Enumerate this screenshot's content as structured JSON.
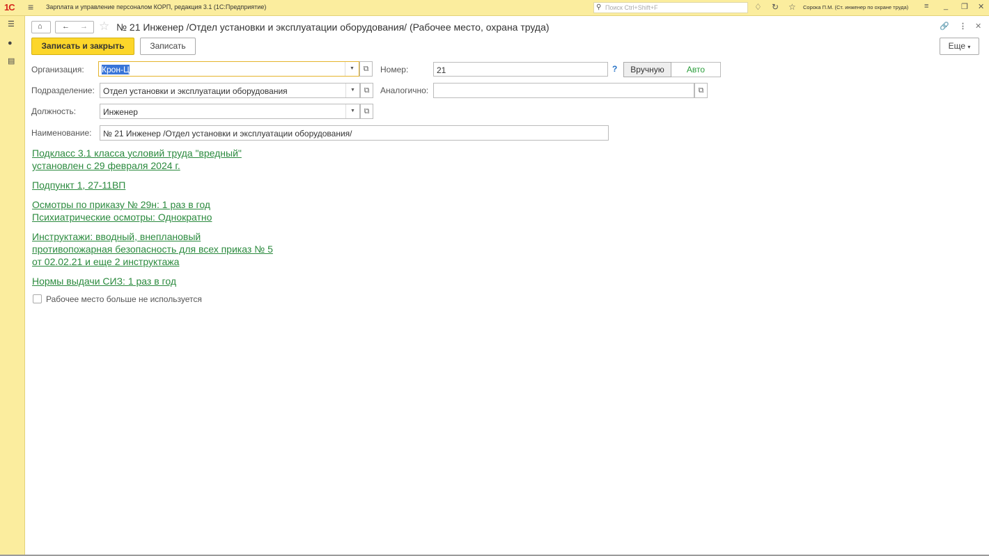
{
  "app": {
    "logo": "1С",
    "title": "Зарплата и управление персоналом КОРП, редакция 3.1  (1С:Предприятие)",
    "search_placeholder": "Поиск Ctrl+Shift+F",
    "user": "Сорока П.М. (Ст. инженер по охране труда)"
  },
  "form": {
    "title": "№ 21 Инженер /Отдел установки и эксплуатации оборудования/ (Рабочее место, охрана труда)",
    "more_button": "Еще",
    "save_close_button": "Записать и закрыть",
    "save_button": "Записать"
  },
  "fields": {
    "organization_label": "Организация:",
    "organization_value": "Крон-Ц",
    "department_label": "Подразделение:",
    "department_value": "Отдел установки и эксплуатации оборудования",
    "position_label": "Должность:",
    "position_value": "Инженер",
    "name_label": "Наименование:",
    "name_value": "№ 21 Инженер /Отдел установки и эксплуатации оборудования/",
    "number_label": "Номер:",
    "number_value": "21",
    "number_help": "?",
    "manual_button": "Вручную",
    "auto_button": "Авто",
    "similar_label": "Аналогично:",
    "similar_value": ""
  },
  "links": {
    "conditions_line1": "Подкласс 3.1 класса условий труда \"вредный\"",
    "conditions_line2": "установлен с 29 февраля 2024 г.",
    "subitem": "Подпункт 1, 27-11ВП",
    "exams_line1": "Осмотры по приказу № 29н: 1 раз в год",
    "exams_line2": "Психиатрические осмотры: Однократно",
    "briefings_line1": "Инструктажи: вводный, внеплановый",
    "briefings_line2": "противопожарная безопасность для всех приказ № 5",
    "briefings_line3": "от 02.02.21 и еще 2 инструктажа",
    "ppe": "Нормы выдачи СИЗ: 1 раз в год"
  },
  "checkbox": {
    "label": "Рабочее место больше не используется",
    "checked": false
  },
  "colors": {
    "accent_yellow": "#fbed9e",
    "primary_button": "#fcd62a",
    "link_green": "#2b8a3e"
  }
}
